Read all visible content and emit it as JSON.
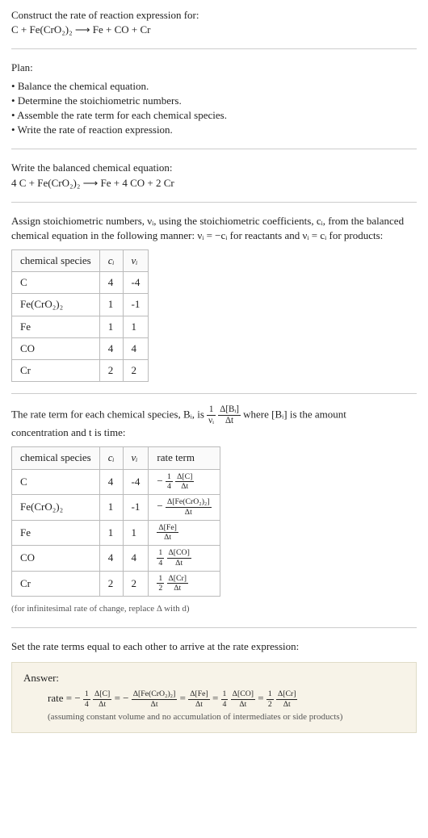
{
  "title_line1": "Construct the rate of reaction expression for:",
  "title_equation": "C + Fe(CrO₂)₂ ⟶ Fe + CO + Cr",
  "plan_h": "Plan:",
  "plan": [
    "Balance the chemical equation.",
    "Determine the stoichiometric numbers.",
    "Assemble the rate term for each chemical species.",
    "Write the rate of reaction expression."
  ],
  "balanced_h": "Write the balanced chemical equation:",
  "balanced_eq": "4 C + Fe(CrO₂)₂ ⟶ Fe + 4 CO + 2 Cr",
  "stoich_text1": "Assign stoichiometric numbers, νᵢ, using the stoichiometric coefficients, cᵢ, from the balanced chemical equation in the following manner: νᵢ = −cᵢ for reactants and νᵢ = cᵢ for products:",
  "t1_h": [
    "chemical species",
    "cᵢ",
    "νᵢ"
  ],
  "t1": [
    {
      "sp": "C",
      "c": "4",
      "v": "-4"
    },
    {
      "sp": "Fe(CrO₂)₂",
      "c": "1",
      "v": "-1"
    },
    {
      "sp": "Fe",
      "c": "1",
      "v": "1"
    },
    {
      "sp": "CO",
      "c": "4",
      "v": "4"
    },
    {
      "sp": "Cr",
      "c": "2",
      "v": "2"
    }
  ],
  "rate_text_pre": "The rate term for each chemical species, Bᵢ, is ",
  "rate_text_post": " where [Bᵢ] is the amount",
  "rate_text_line2": "concentration and t is time:",
  "t2_h": [
    "chemical species",
    "cᵢ",
    "νᵢ",
    "rate term"
  ],
  "t2": [
    {
      "sp": "C",
      "c": "4",
      "v": "-4",
      "neg": "− ",
      "f1n": "1",
      "f1d": "4",
      "f2n": "Δ[C]",
      "f2d": "Δt"
    },
    {
      "sp": "Fe(CrO₂)₂",
      "c": "1",
      "v": "-1",
      "neg": "− ",
      "f1n": "",
      "f1d": "",
      "f2n": "Δ[Fe(CrO₂)₂]",
      "f2d": "Δt"
    },
    {
      "sp": "Fe",
      "c": "1",
      "v": "1",
      "neg": "",
      "f1n": "",
      "f1d": "",
      "f2n": "Δ[Fe]",
      "f2d": "Δt"
    },
    {
      "sp": "CO",
      "c": "4",
      "v": "4",
      "neg": "",
      "f1n": "1",
      "f1d": "4",
      "f2n": "Δ[CO]",
      "f2d": "Δt"
    },
    {
      "sp": "Cr",
      "c": "2",
      "v": "2",
      "neg": "",
      "f1n": "1",
      "f1d": "2",
      "f2n": "Δ[Cr]",
      "f2d": "Δt"
    }
  ],
  "inf_note": "(for infinitesimal rate of change, replace Δ with d)",
  "set_equal": "Set the rate terms equal to each other to arrive at the rate expression:",
  "answer_h": "Answer:",
  "ans_lead": "rate = − ",
  "answer_note": "(assuming constant volume and no accumulation of intermediates or side products)",
  "ans": {
    "a_n": "1",
    "a_d": "4",
    "a2n": "Δ[C]",
    "a2d": "Δt",
    "b2n": "Δ[Fe(CrO₂)₂]",
    "b2d": "Δt",
    "c2n": "Δ[Fe]",
    "c2d": "Δt",
    "d_n": "1",
    "d_d": "4",
    "d2n": "Δ[CO]",
    "d2d": "Δt",
    "e_n": "1",
    "e_d": "2",
    "e2n": "Δ[Cr]",
    "e2d": "Δt"
  },
  "frac_1": {
    "n": "1",
    "d": "νᵢ"
  },
  "frac_2": {
    "n": "Δ[Bᵢ]",
    "d": "Δt"
  },
  "chart_data": {
    "type": "table",
    "tables": [
      {
        "columns": [
          "chemical species",
          "c_i",
          "nu_i"
        ],
        "rows": [
          [
            "C",
            4,
            -4
          ],
          [
            "Fe(CrO2)2",
            1,
            -1
          ],
          [
            "Fe",
            1,
            1
          ],
          [
            "CO",
            4,
            4
          ],
          [
            "Cr",
            2,
            2
          ]
        ]
      },
      {
        "columns": [
          "chemical species",
          "c_i",
          "nu_i",
          "rate term"
        ],
        "rows": [
          [
            "C",
            4,
            -4,
            "-(1/4)(Δ[C]/Δt)"
          ],
          [
            "Fe(CrO2)2",
            1,
            -1,
            "-(Δ[Fe(CrO2)2]/Δt)"
          ],
          [
            "Fe",
            1,
            1,
            "(Δ[Fe]/Δt)"
          ],
          [
            "CO",
            4,
            4,
            "(1/4)(Δ[CO]/Δt)"
          ],
          [
            "Cr",
            2,
            2,
            "(1/2)(Δ[Cr]/Δt)"
          ]
        ]
      }
    ]
  }
}
